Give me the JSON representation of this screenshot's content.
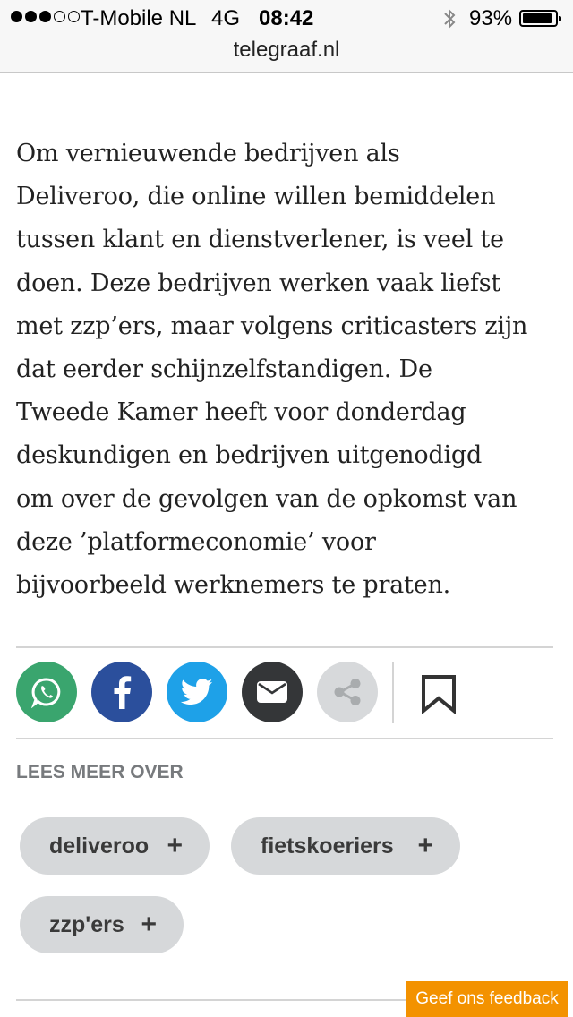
{
  "status_bar": {
    "carrier": "T-Mobile NL",
    "network": "4G",
    "time": "08:42",
    "battery_percent": "93%",
    "signal_bars_filled": 3,
    "signal_bars_total": 5,
    "battery_level": 0.93
  },
  "browser": {
    "url": "telegraaf.nl"
  },
  "article": {
    "lines": [
      "Om vernieuwende bedrijven als",
      "Deliveroo, die online willen bemiddelen",
      "tussen klant en dienstverlener, is veel te",
      "doen. Deze bedrijven werken vaak liefst",
      "met zzp’ers, maar volgens criticasters zijn",
      "dat eerder schijnzelfstandigen. De",
      "Tweede Kamer heeft voor donderdag",
      "deskundigen en bedrijven uitgenodigd",
      "om over de gevolgen van de opkomst van",
      "deze ’platformeconomie’ voor",
      "bijvoorbeeld werknemers te praten."
    ]
  },
  "share_buttons": [
    {
      "icon": "whatsapp-icon",
      "color": "#3aa56e"
    },
    {
      "icon": "facebook-icon",
      "color": "#2b4f9c"
    },
    {
      "icon": "twitter-icon",
      "color": "#1ea1e8"
    },
    {
      "icon": "mail-icon",
      "color": "#343638"
    },
    {
      "icon": "share-icon",
      "color": "#d7d9db"
    }
  ],
  "bookmark": {
    "icon": "bookmark-icon"
  },
  "related": {
    "heading": "LEES MEER OVER",
    "tags": [
      {
        "label": "deliveroo",
        "action": "+"
      },
      {
        "label": "fietskoeriers",
        "action": "+"
      },
      {
        "label": "zzp'ers",
        "action": "+"
      }
    ]
  },
  "feedback_button": {
    "label": "Geef ons feedback",
    "color": "#f39200"
  }
}
